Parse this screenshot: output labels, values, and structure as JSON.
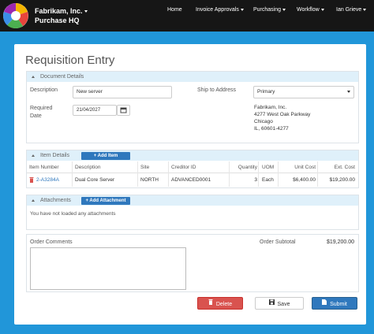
{
  "header": {
    "company": "Fabrikam, Inc.",
    "app_name": "Purchase HQ",
    "nav": [
      {
        "label": "Home",
        "has_caret": false
      },
      {
        "label": "Invoice Approvals",
        "has_caret": true
      },
      {
        "label": "Purchasing",
        "has_caret": true
      },
      {
        "label": "Workflow",
        "has_caret": true
      },
      {
        "label": "Ian Grieve",
        "has_caret": true
      }
    ]
  },
  "page": {
    "title": "Requisition Entry"
  },
  "document_details": {
    "section_title": "Document Details",
    "description_label": "Description",
    "description_value": "New server",
    "required_date_label_1": "Required",
    "required_date_label_2": "Date",
    "required_date_value": "21/04/2027",
    "ship_to_label": "Ship to Address",
    "ship_to_value": "Primary",
    "address_lines": [
      "Fabrikam, Inc.",
      "4277 West Oak Parkway",
      "Chicago",
      "IL, 60601-4277"
    ]
  },
  "item_details": {
    "section_title": "Item Details",
    "add_button": "Add Item",
    "columns": [
      "Item Number",
      "Description",
      "Site",
      "Creditor ID",
      "Quantity",
      "UOM",
      "Unit Cost",
      "Ext. Cost"
    ],
    "rows": [
      {
        "item_number": "2-A3284A",
        "description": "Dual Core Server",
        "site": "NORTH",
        "creditor_id": "ADVANCED0001",
        "quantity": "3",
        "uom": "Each",
        "unit_cost": "$6,400.00",
        "ext_cost": "$19,200.00"
      }
    ]
  },
  "attachments": {
    "section_title": "Attachments",
    "add_button": "Add Attachment",
    "empty_message": "You have not loaded any attachments"
  },
  "summary": {
    "comments_label": "Order Comments",
    "comments_value": "",
    "subtotal_label": "Order Subtotal",
    "subtotal_value": "$19,200.00"
  },
  "actions": {
    "delete": "Delete",
    "save": "Save",
    "submit": "Submit"
  },
  "colors": {
    "background": "#2196d9",
    "navbar": "#161616",
    "section_header": "#dff0fa",
    "primary": "#2f78bd",
    "danger": "#d9534f",
    "link": "#2f78bd"
  }
}
